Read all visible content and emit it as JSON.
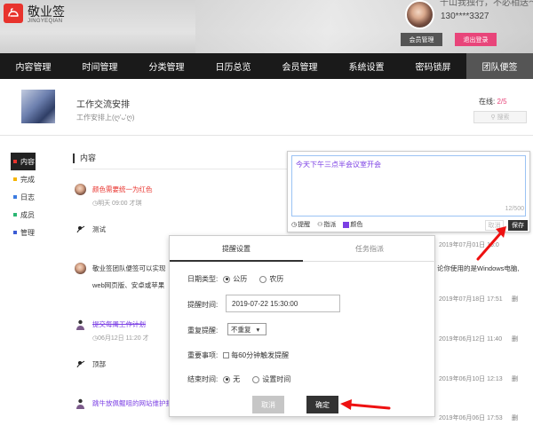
{
  "header": {
    "app_title": "敬业签",
    "app_subtitle": "JINGYEQIAN",
    "motto": "千山我独行，不必相送～",
    "phone": "130****3327",
    "member_btn": "会员管理",
    "logout_btn": "退出登录",
    "brand_color": "#e8332d"
  },
  "nav": {
    "items": [
      "内容管理",
      "时间管理",
      "分类管理",
      "日历总览",
      "会员管理",
      "系统设置",
      "密码锁屏",
      "团队便签"
    ],
    "active_index": 7
  },
  "group": {
    "name": "工作交流安排",
    "desc": "工作安排上(ღ'ᴗ'ღ)",
    "online_label": "在线:",
    "online_value": "2/5",
    "search_placeholder": "搜索"
  },
  "sidebar": {
    "items": [
      {
        "label": "内容",
        "color": "#e8332d"
      },
      {
        "label": "完成",
        "color": "#f5b400"
      },
      {
        "label": "日志",
        "color": "#3b7be0"
      },
      {
        "label": "成员",
        "color": "#2bb673"
      },
      {
        "label": "管理",
        "color": "#3b5bd4"
      }
    ]
  },
  "content": {
    "heading": "内容",
    "items": [
      {
        "text": "颜色需要统一为红色",
        "meta": "明天 09:00  才琪",
        "date": "",
        "ops": ""
      },
      {
        "text": "测试",
        "meta": "",
        "date": "2019年07月01日 15:0",
        "ops": ""
      },
      {
        "text": "敬业签团队便签可以实现",
        "text2": "web网页版、安卓或苹果",
        "text_right": "论你使用的是Windows电脑,",
        "meta": "",
        "date": "2019年07月18日 17:51",
        "ops": "删"
      },
      {
        "text": "提交每周工作计划",
        "meta": "06月12日 11:20  才",
        "date": "2019年06月12日 11:40",
        "ops": "删"
      },
      {
        "text": "顶部",
        "meta": "",
        "date": "2019年06月10日 12:13",
        "ops": "删"
      },
      {
        "text": "跳牛放佩鲲咀的网站维护报",
        "meta": "",
        "date": "2019年06月06日 17:53",
        "ops": "删"
      }
    ]
  },
  "editor": {
    "text": "今天下午三点半会议室开会",
    "count": "12/500",
    "tools": [
      "提醒",
      "指派",
      "颜色"
    ],
    "cancel": "取消",
    "save": "保存"
  },
  "modal": {
    "tabs": [
      "提醒设置",
      "任务指派"
    ],
    "date_type_label": "日期类型:",
    "date_type_options": [
      "公历",
      "农历"
    ],
    "remind_time_label": "提醒时间:",
    "remind_time_value": "2019-07-22 15:30:00",
    "repeat_label": "重复提醒:",
    "repeat_value": "不重复",
    "important_label": "重要事项:",
    "important_option": "每60分钟触发提醒",
    "end_time_label": "结束时间:",
    "end_time_options": [
      "无",
      "设置时间"
    ],
    "cancel": "取消",
    "confirm": "确定"
  }
}
